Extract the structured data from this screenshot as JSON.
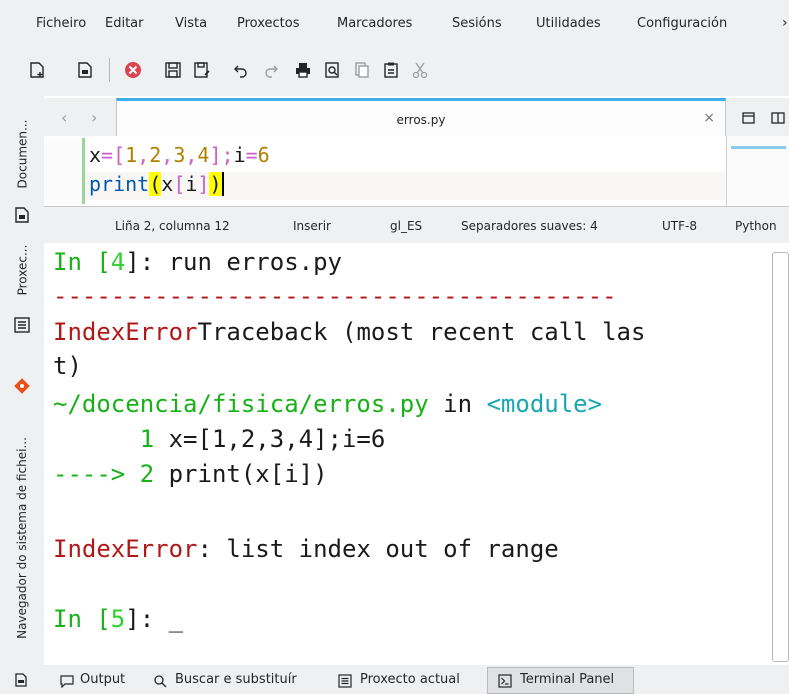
{
  "menubar": {
    "items": [
      "Ficheiro",
      "Editar",
      "Vista",
      "Proxectos",
      "Marcadores",
      "Sesións",
      "Utilidades",
      "Configuración"
    ],
    "overflow": "›"
  },
  "toolbar": {
    "buttons": [
      "new-document",
      "open-document",
      "close-document",
      "save",
      "save-as",
      "undo",
      "redo",
      "print",
      "print-preview",
      "copy",
      "paste",
      "cut"
    ]
  },
  "sidebar": {
    "tabs": [
      "Documen...",
      "Proxec...",
      "Navegador do sistema de fichei..."
    ]
  },
  "tabbar": {
    "back": "‹",
    "forward": "›",
    "active_tab": "erros.py",
    "close": "×"
  },
  "editor": {
    "line1": {
      "x": "x",
      "eq": "=",
      "lb": "[",
      "n1": "1",
      "c1": ",",
      "n2": "2",
      "c2": ",",
      "n3": "3",
      "c3": ",",
      "n4": "4",
      "rb": "]",
      "semi": ";",
      "i": "i",
      "eq2": "=",
      "n6": "6"
    },
    "line2": {
      "print": "print",
      "lp": "(",
      "x": "x",
      "lb": "[",
      "i": "i",
      "rb": "]",
      "rp": ")"
    }
  },
  "statusbar": {
    "position": "Liña 2, columna 12",
    "mode": "Inserir",
    "language_dict": "gl_ES",
    "indent": "Separadores suaves: 4",
    "encoding": "UTF-8",
    "syntax": "Python"
  },
  "terminal": {
    "prompt1_pre": "In [",
    "prompt1_num": "4",
    "prompt1_post": "]: run erros.py",
    "dashes": "---------------------------------------",
    "err_name": "IndexError",
    "err_trace": "Traceback (most recent call las",
    "err_trace2": "t)",
    "path": "~/docencia/fisica/erros.py",
    "path_in": " in ",
    "module": "<module>",
    "src1_num": "      1 ",
    "src1_code": "x=[1,2,3,4];i=6",
    "arrow": "----> ",
    "src2_num": "2 ",
    "src2_code": "print(x[i])",
    "final_err": "IndexError",
    "final_msg": ": list index out of range",
    "prompt2_pre": "In [",
    "prompt2_num": "5",
    "prompt2_post": "]: _"
  },
  "bottombar": {
    "items": [
      "Output",
      "Buscar e substituír",
      "Proxecto actual",
      "Terminal Panel"
    ]
  }
}
